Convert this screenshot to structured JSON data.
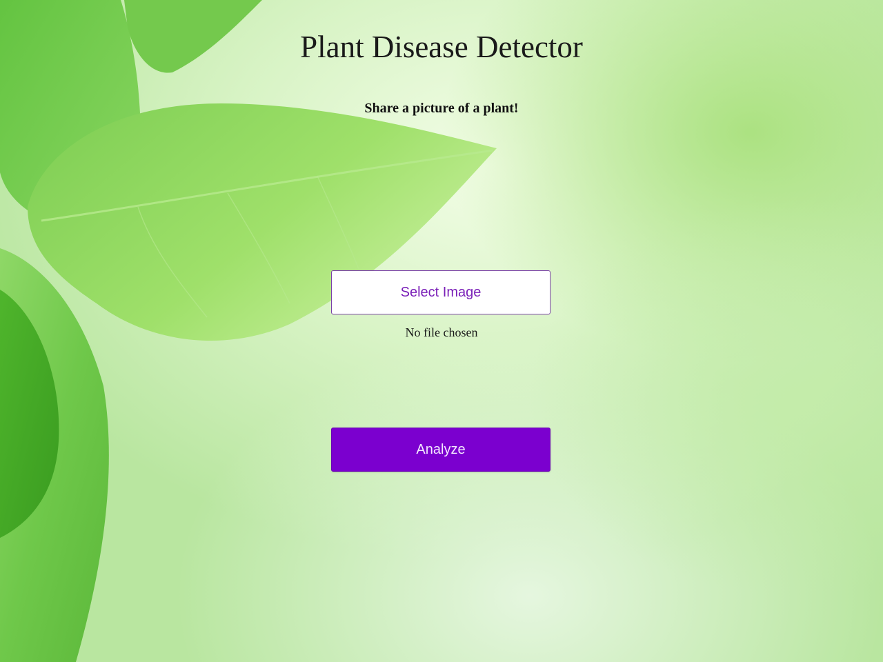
{
  "header": {
    "title": "Plant Disease Detector",
    "subtitle": "Share a picture of a plant!"
  },
  "upload": {
    "select_label": "Select Image",
    "file_status": "No file chosen"
  },
  "actions": {
    "analyze_label": "Analyze"
  },
  "colors": {
    "accent": "#7b00cf",
    "select_text": "#7a1fb8",
    "background": "#cfeec0"
  },
  "icons": {
    "background": "leaf-background-image"
  }
}
